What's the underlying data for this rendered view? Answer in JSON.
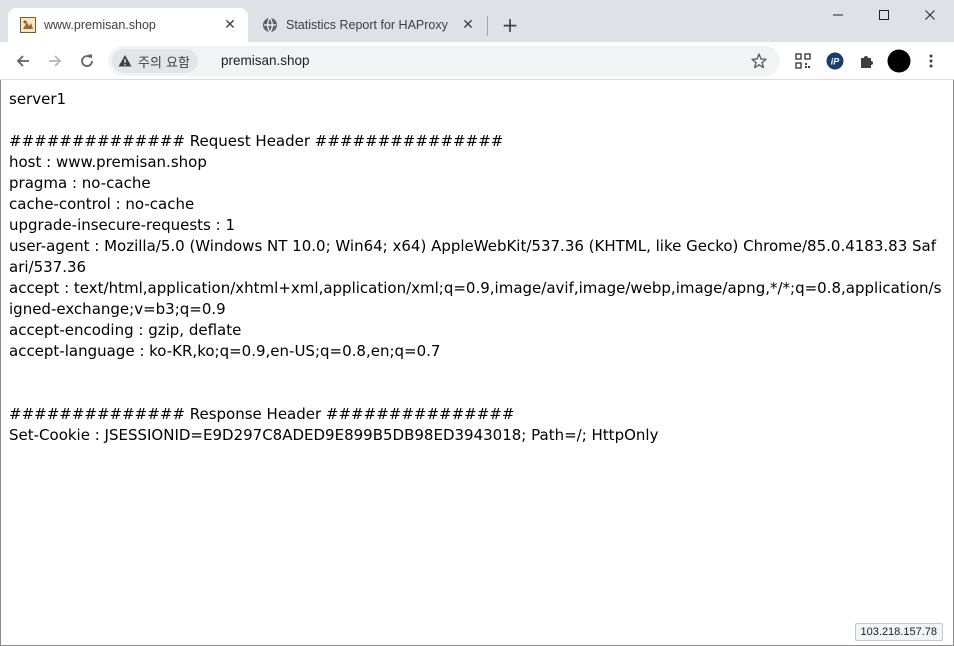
{
  "browser": {
    "tabs": [
      {
        "title": "www.premisan.shop",
        "icon": "site-favicon",
        "active": true
      },
      {
        "title": "Statistics Report for HAProxy",
        "icon": "globe-icon",
        "active": false
      }
    ],
    "new_tab_label": "+",
    "window_controls": {
      "minimize": "─",
      "maximize": "☐",
      "close": "✕"
    }
  },
  "toolbar": {
    "security_label": "주의 요함",
    "url": "premisan.shop",
    "extensions": [
      "qr-icon",
      "ip-extension-icon",
      "puzzle-icon",
      "avatar"
    ]
  },
  "page": {
    "lines": [
      "server1",
      "",
      "############## Request Header ###############",
      "host : www.premisan.shop",
      "pragma : no-cache",
      "cache-control : no-cache",
      "upgrade-insecure-requests : 1",
      "user-agent : Mozilla/5.0 (Windows NT 10.0; Win64; x64) AppleWebKit/537.36 (KHTML, like Gecko) Chrome/85.0.4183.83 Safari/537.36",
      "accept : text/html,application/xhtml+xml,application/xml;q=0.9,image/avif,image/webp,image/apng,*/*;q=0.8,application/signed-exchange;v=b3;q=0.9",
      "accept-encoding : gzip, deflate",
      "accept-language : ko-KR,ko;q=0.9,en-US;q=0.8,en;q=0.7",
      "",
      "",
      "############## Response Header ###############",
      "Set-Cookie : JSESSIONID=E9D297C8ADED9E899B5DB98ED3943018; Path=/; HttpOnly"
    ]
  },
  "status_bar": {
    "text": "103.218.157.78"
  }
}
